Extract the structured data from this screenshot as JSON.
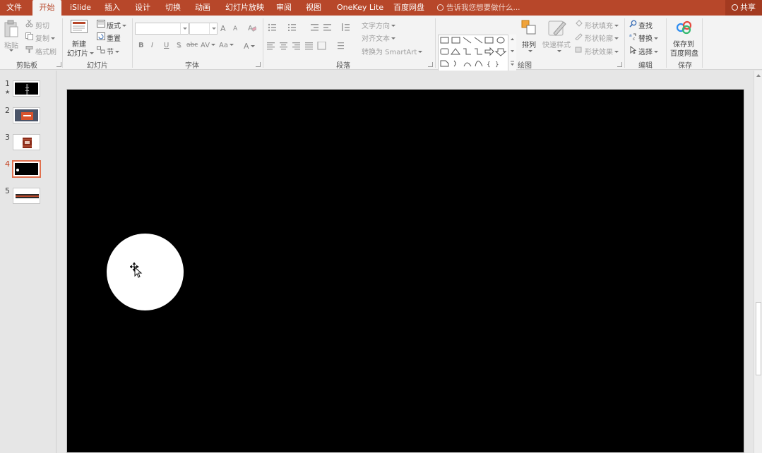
{
  "tabs": [
    {
      "label": "文件",
      "active": false
    },
    {
      "label": "开始",
      "active": true
    },
    {
      "label": "iSlide",
      "active": false
    },
    {
      "label": "插入",
      "active": false
    },
    {
      "label": "设计",
      "active": false
    },
    {
      "label": "切换",
      "active": false
    },
    {
      "label": "动画",
      "active": false
    },
    {
      "label": "幻灯片放映",
      "active": false
    },
    {
      "label": "审阅",
      "active": false
    },
    {
      "label": "视图",
      "active": false
    },
    {
      "label": "OneKey Lite",
      "active": false
    },
    {
      "label": "百度网盘",
      "active": false
    }
  ],
  "tell_me": "告诉我您想要做什么...",
  "share": "共享",
  "clipboard": {
    "paste": "粘贴",
    "cut": "剪切",
    "copy": "复制",
    "format_painter": "格式刷",
    "label": "剪贴板"
  },
  "slides_group": {
    "new_slide_line1": "新建",
    "new_slide_line2": "幻灯片",
    "layout": "版式",
    "reset": "重置",
    "section": "节",
    "label": "幻灯片"
  },
  "font_group": {
    "font_name": "",
    "font_size": "",
    "label": "字体",
    "bold": "B",
    "italic": "I",
    "underline": "U",
    "shadow": "S",
    "strike": "abc",
    "spacing": "AV",
    "case": "Aa",
    "grow": "A",
    "shrink": "A"
  },
  "paragraph_group": {
    "text_direction": "文字方向",
    "align_text": "对齐文本",
    "smartart": "转换为 SmartArt",
    "label": "段落"
  },
  "drawing_group": {
    "arrange": "排列",
    "quick_styles": "快速样式",
    "shape_fill": "形状填充",
    "shape_outline": "形状轮廓",
    "shape_effects": "形状效果",
    "label": "绘图"
  },
  "editing_group": {
    "find": "查找",
    "replace": "替换",
    "select": "选择",
    "label": "编辑"
  },
  "save_group": {
    "save_line1": "保存到",
    "save_line2": "百度网盘",
    "label": "保存"
  },
  "thumbnails": [
    {
      "number": "1",
      "has_animation": true,
      "star": "★",
      "active": false
    },
    {
      "number": "2",
      "has_animation": false,
      "active": false
    },
    {
      "number": "3",
      "has_animation": false,
      "active": false
    },
    {
      "number": "4",
      "has_animation": false,
      "active": true
    },
    {
      "number": "5",
      "has_animation": false,
      "active": false
    }
  ],
  "colors": {
    "accent": "#b7472a",
    "ribbon_bg": "#f3f3f3",
    "slide_bg": "#000000",
    "shape_fill": "#ffffff",
    "active_thumb_border": "#e0704e"
  }
}
